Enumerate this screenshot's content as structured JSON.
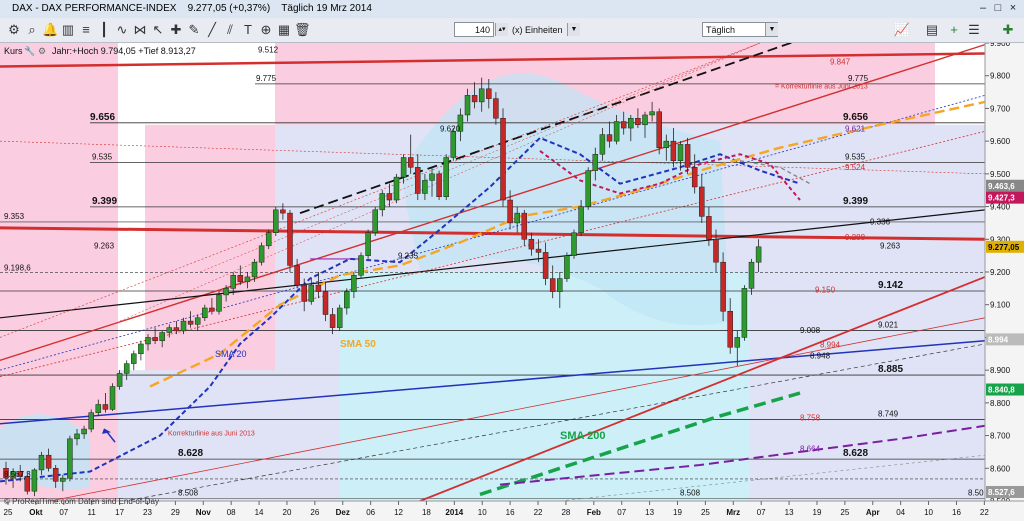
{
  "window": {
    "title": "DAX - DAX PERFORMANCE-INDEX",
    "last_price": "9.277,05 (+0,37%)",
    "period": "Täglich",
    "date": "19 Mrz 2014"
  },
  "toolbar": {
    "bars_value": "140",
    "units_label": "(x) Einheiten",
    "timeframe_value": "Täglich",
    "icons": [
      "settings-icon",
      "search-icon",
      "alarm-bell-icon",
      "bar-chart-icon",
      "fibonacci-icon",
      "candles-icon",
      "line-chart-icon",
      "pattern-icon",
      "pointer-icon",
      "crosshair-icon",
      "pencil-icon",
      "line-tool-icon",
      "channel-icon",
      "text-tool-icon",
      "zoom-icon",
      "grid-icon",
      "delete-icon"
    ]
  },
  "panel": {
    "name": "Kurs",
    "stats": "Jahr:+Hoch 9.794,05 +Tief 8.913,27"
  },
  "watermark": "© ProRealTime.com  Daten sind End-of-Day",
  "chart_data": {
    "type": "candlestick",
    "instrument": "DAX PERFORMANCE-INDEX",
    "timeframe": "Täglich",
    "ylim": [
      8500,
      9900
    ],
    "y_ticks": [
      "9.900",
      "9.800",
      "9.700",
      "9.600",
      "9.500",
      "9.400",
      "9.300",
      "9.200",
      "9.100",
      "9.000",
      "8.900",
      "8.800",
      "8.700",
      "8.600",
      "8.500"
    ],
    "x_ticks": [
      "25",
      "Okt",
      "07",
      "11",
      "17",
      "23",
      "29",
      "Nov",
      "08",
      "14",
      "20",
      "26",
      "Dez",
      "06",
      "12",
      "18",
      "2014",
      "10",
      "16",
      "22",
      "28",
      "Feb",
      "07",
      "13",
      "19",
      "25",
      "Mrz",
      "07",
      "13",
      "19",
      "25",
      "Apr",
      "04",
      "10",
      "16",
      "22"
    ],
    "price_tags": [
      {
        "label": "9.463,6",
        "value": 9463.6,
        "color": "#888888"
      },
      {
        "label": "9.427,3",
        "value": 9427.3,
        "color": "#c2185b"
      },
      {
        "label": "9.277,05",
        "value": 9277.05,
        "color": "#e0b000"
      },
      {
        "label": "8.994",
        "value": 8994,
        "color": "#bbbbbb"
      },
      {
        "label": "8.840,8",
        "value": 8840.8,
        "color": "#16a34a"
      },
      {
        "label": "8.527,6",
        "value": 8527.6,
        "color": "#999999"
      }
    ],
    "level_labels": [
      {
        "text": "9.775",
        "value": 9775
      },
      {
        "text": "9.656",
        "value": 9656
      },
      {
        "text": "9.620",
        "value": 9620
      },
      {
        "text": "9.535",
        "value": 9535
      },
      {
        "text": "9.399",
        "value": 9399
      },
      {
        "text": "9.353",
        "value": 9353
      },
      {
        "text": "9.336",
        "value": 9336
      },
      {
        "text": "9.288",
        "value": 9288
      },
      {
        "text": "9.263",
        "value": 9263
      },
      {
        "text": "9.235",
        "value": 9235
      },
      {
        "text": "9.198,6",
        "value": 9198.6
      },
      {
        "text": "9.150",
        "value": 9150
      },
      {
        "text": "9.142",
        "value": 9142
      },
      {
        "text": "9.021",
        "value": 9021
      },
      {
        "text": "9.008",
        "value": 9008
      },
      {
        "text": "8.994",
        "value": 8994
      },
      {
        "text": "8.948",
        "value": 8948
      },
      {
        "text": "8.885",
        "value": 8885
      },
      {
        "text": "8.758",
        "value": 8758
      },
      {
        "text": "8.749",
        "value": 8749
      },
      {
        "text": "8.664",
        "value": 8664
      },
      {
        "text": "8.628",
        "value": 8628
      },
      {
        "text": "8.567,3",
        "value": 8567.3
      },
      {
        "text": "8.508",
        "value": 8508
      },
      {
        "text": "9.847",
        "value": 9847
      },
      {
        "text": "9.621",
        "value": 9621
      },
      {
        "text": "9.524",
        "value": 9524
      },
      {
        "text": "9.512",
        "value": 9895
      }
    ],
    "annotations": [
      "SMA 20",
      "SMA 50",
      "SMA 200",
      "Korrekturlinie aus Juni 2013",
      "= Korrekturlinie aus Juni 2013"
    ],
    "candles": [
      [
        8600,
        8620,
        8550,
        8570
      ],
      [
        8570,
        8600,
        8540,
        8590
      ],
      [
        8590,
        8610,
        8560,
        8575
      ],
      [
        8575,
        8590,
        8520,
        8530
      ],
      [
        8530,
        8600,
        8515,
        8595
      ],
      [
        8595,
        8650,
        8580,
        8640
      ],
      [
        8640,
        8660,
        8590,
        8600
      ],
      [
        8600,
        8610,
        8540,
        8560
      ],
      [
        8560,
        8580,
        8530,
        8570
      ],
      [
        8570,
        8700,
        8560,
        8690
      ],
      [
        8690,
        8720,
        8670,
        8705
      ],
      [
        8705,
        8730,
        8690,
        8720
      ],
      [
        8720,
        8780,
        8710,
        8770
      ],
      [
        8770,
        8810,
        8760,
        8795
      ],
      [
        8795,
        8830,
        8770,
        8780
      ],
      [
        8780,
        8860,
        8775,
        8850
      ],
      [
        8850,
        8900,
        8840,
        8890
      ],
      [
        8890,
        8930,
        8870,
        8920
      ],
      [
        8920,
        8960,
        8900,
        8950
      ],
      [
        8950,
        8990,
        8930,
        8980
      ],
      [
        8980,
        9010,
        8960,
        9000
      ],
      [
        9000,
        9030,
        8980,
        8990
      ],
      [
        8990,
        9020,
        8970,
        9015
      ],
      [
        9015,
        9040,
        9000,
        9030
      ],
      [
        9030,
        9050,
        9010,
        9020
      ],
      [
        9020,
        9060,
        9010,
        9050
      ],
      [
        9050,
        9080,
        9030,
        9040
      ],
      [
        9040,
        9070,
        9020,
        9060
      ],
      [
        9060,
        9100,
        9050,
        9090
      ],
      [
        9090,
        9120,
        9070,
        9080
      ],
      [
        9080,
        9140,
        9070,
        9130
      ],
      [
        9130,
        9160,
        9110,
        9150
      ],
      [
        9150,
        9200,
        9130,
        9190
      ],
      [
        9190,
        9220,
        9160,
        9170
      ],
      [
        9170,
        9200,
        9150,
        9185
      ],
      [
        9185,
        9240,
        9170,
        9230
      ],
      [
        9230,
        9290,
        9220,
        9280
      ],
      [
        9280,
        9330,
        9270,
        9320
      ],
      [
        9320,
        9400,
        9310,
        9390
      ],
      [
        9390,
        9410,
        9360,
        9380
      ],
      [
        9380,
        9390,
        9200,
        9220
      ],
      [
        9220,
        9240,
        9150,
        9160
      ],
      [
        9160,
        9180,
        9080,
        9110
      ],
      [
        9110,
        9180,
        9100,
        9160
      ],
      [
        9160,
        9200,
        9120,
        9140
      ],
      [
        9140,
        9170,
        9050,
        9070
      ],
      [
        9070,
        9090,
        9010,
        9030
      ],
      [
        9030,
        9100,
        9020,
        9090
      ],
      [
        9090,
        9150,
        9070,
        9140
      ],
      [
        9140,
        9200,
        9120,
        9190
      ],
      [
        9190,
        9260,
        9180,
        9250
      ],
      [
        9250,
        9330,
        9240,
        9320
      ],
      [
        9320,
        9400,
        9310,
        9390
      ],
      [
        9390,
        9450,
        9370,
        9440
      ],
      [
        9440,
        9470,
        9400,
        9420
      ],
      [
        9420,
        9500,
        9410,
        9490
      ],
      [
        9490,
        9560,
        9470,
        9550
      ],
      [
        9550,
        9620,
        9500,
        9520
      ],
      [
        9520,
        9560,
        9420,
        9440
      ],
      [
        9440,
        9500,
        9420,
        9480
      ],
      [
        9480,
        9520,
        9430,
        9500
      ],
      [
        9500,
        9510,
        9420,
        9430
      ],
      [
        9430,
        9560,
        9420,
        9550
      ],
      [
        9550,
        9640,
        9540,
        9630
      ],
      [
        9630,
        9700,
        9600,
        9680
      ],
      [
        9680,
        9760,
        9660,
        9740
      ],
      [
        9740,
        9780,
        9700,
        9720
      ],
      [
        9720,
        9794,
        9690,
        9760
      ],
      [
        9760,
        9790,
        9700,
        9730
      ],
      [
        9730,
        9750,
        9650,
        9670
      ],
      [
        9670,
        9700,
        9400,
        9420
      ],
      [
        9420,
        9450,
        9330,
        9350
      ],
      [
        9350,
        9400,
        9320,
        9380
      ],
      [
        9380,
        9390,
        9280,
        9300
      ],
      [
        9300,
        9320,
        9250,
        9270
      ],
      [
        9270,
        9300,
        9230,
        9260
      ],
      [
        9260,
        9290,
        9160,
        9180
      ],
      [
        9180,
        9220,
        9120,
        9140
      ],
      [
        9140,
        9200,
        9090,
        9180
      ],
      [
        9180,
        9260,
        9170,
        9250
      ],
      [
        9250,
        9330,
        9240,
        9320
      ],
      [
        9320,
        9420,
        9310,
        9400
      ],
      [
        9400,
        9520,
        9390,
        9510
      ],
      [
        9510,
        9580,
        9480,
        9560
      ],
      [
        9560,
        9640,
        9540,
        9620
      ],
      [
        9620,
        9660,
        9580,
        9600
      ],
      [
        9600,
        9680,
        9590,
        9660
      ],
      [
        9660,
        9690,
        9620,
        9640
      ],
      [
        9640,
        9680,
        9600,
        9670
      ],
      [
        9670,
        9700,
        9640,
        9650
      ],
      [
        9650,
        9690,
        9610,
        9680
      ],
      [
        9680,
        9720,
        9660,
        9690
      ],
      [
        9690,
        9700,
        9560,
        9580
      ],
      [
        9580,
        9620,
        9540,
        9600
      ],
      [
        9600,
        9640,
        9520,
        9540
      ],
      [
        9540,
        9600,
        9510,
        9590
      ],
      [
        9590,
        9610,
        9500,
        9520
      ],
      [
        9520,
        9560,
        9440,
        9460
      ],
      [
        9460,
        9500,
        9350,
        9370
      ],
      [
        9370,
        9400,
        9280,
        9300
      ],
      [
        9300,
        9330,
        9200,
        9230
      ],
      [
        9230,
        9260,
        9050,
        9080
      ],
      [
        9080,
        9120,
        8950,
        8970
      ],
      [
        8970,
        9020,
        8913,
        9000
      ],
      [
        9000,
        9160,
        8990,
        9150
      ],
      [
        9150,
        9240,
        9130,
        9230
      ],
      [
        9230,
        9300,
        9200,
        9277
      ]
    ]
  }
}
